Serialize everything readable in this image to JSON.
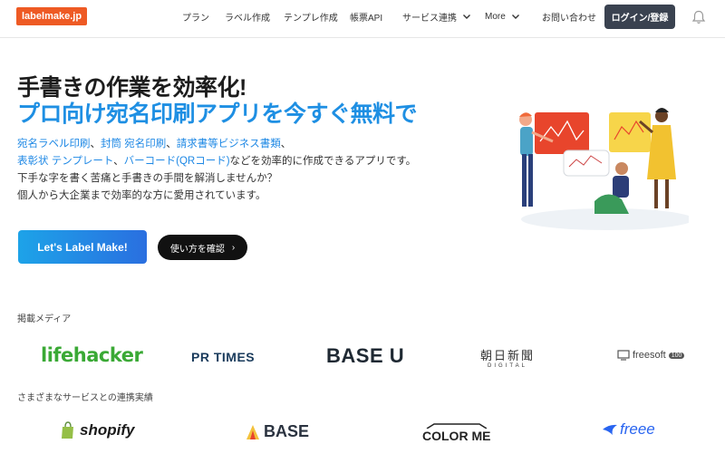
{
  "header": {
    "logo": "labelmake.jp",
    "nav": [
      {
        "label": "プラン"
      },
      {
        "label": "ラベル作成"
      },
      {
        "label": "テンプレ作成"
      },
      {
        "label": "帳票API"
      },
      {
        "label": "サービス連携",
        "dropdown": true
      },
      {
        "label": "More",
        "dropdown": true
      },
      {
        "label": "お問い合わせ"
      }
    ],
    "login": "ログイン/登録",
    "bell_icon": "bell-icon"
  },
  "hero": {
    "title_line1": "手書きの作業を効率化!",
    "title_line2": "プロ向け宛名印刷アプリを今すぐ無料で",
    "desc": {
      "l1_links": [
        "宛名ラベル印刷",
        "封筒 宛名印刷",
        "請求書等ビジネス書類"
      ],
      "l1_sep": "、",
      "l2_links": [
        "表彰状 テンプレート",
        "バーコード(QRコード)"
      ],
      "l2_rest": "などを効率的に作成できるアプリです。",
      "l3": "下手な字を書く苦痛と手書きの手間を解消しませんか？",
      "l4": "個人から大企業まで効率的な方に愛用されています。"
    },
    "cta": "Let's Label Make!",
    "howto": "使い方を確認",
    "accent_color": "#1e8fe3"
  },
  "media": {
    "title": "掲載メディア",
    "logos": {
      "lifehacker": "lifehacker",
      "prtimes": "PR TIMES",
      "baseu": "BASE U",
      "asahi_main": "朝日新聞",
      "asahi_sub": "DIGITAL",
      "freesoft": "freesoft",
      "freesoft_badge": "100"
    }
  },
  "services": {
    "title": "さまざまなサービスとの連携実績",
    "logos": {
      "shopify": "shopify",
      "base": "BASE",
      "colorme": "COLOR ME",
      "freee": "freee"
    }
  }
}
